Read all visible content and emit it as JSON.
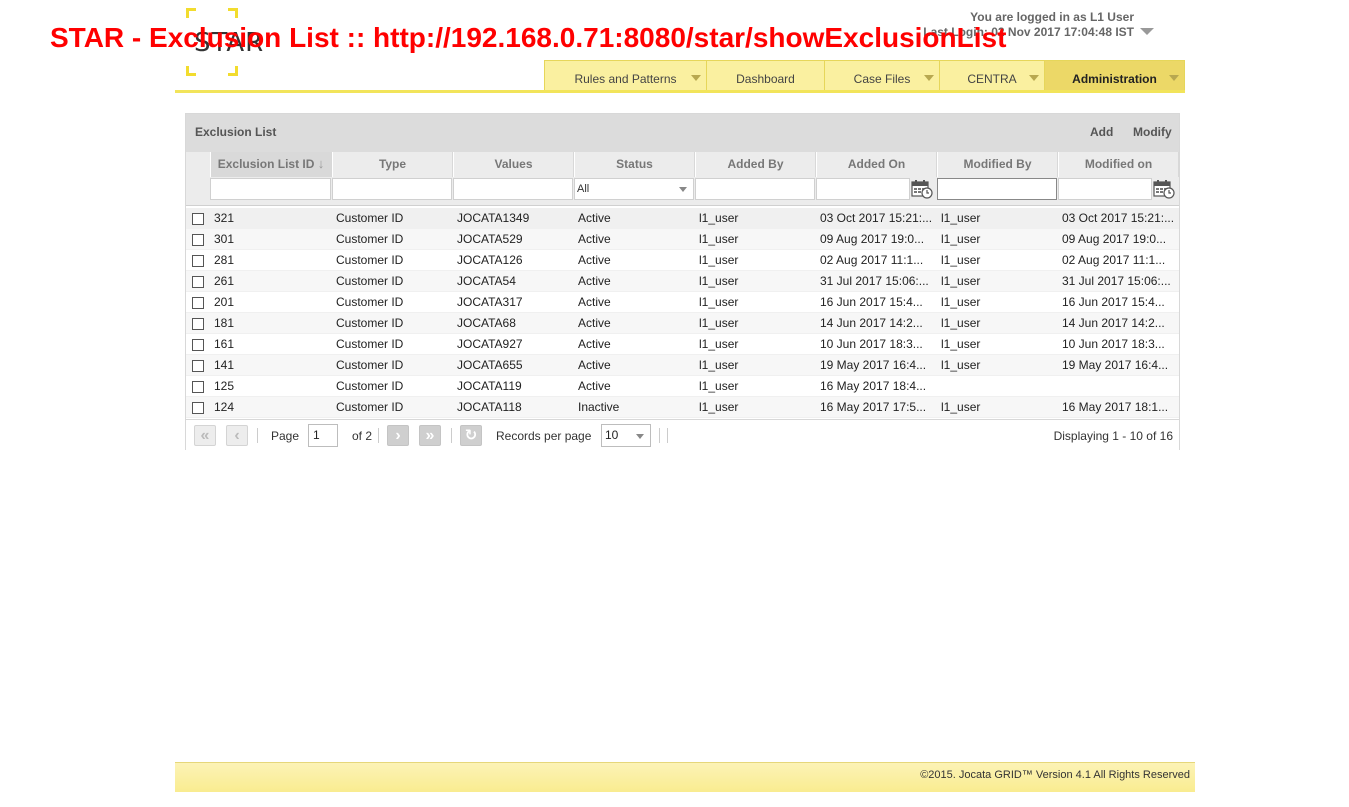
{
  "overlay": {
    "title": "STAR - Exclusion List :: http://192.168.0.71:8080/star/showExclusionList"
  },
  "logo": {
    "text": "STAR"
  },
  "user": {
    "logged_in": "You are logged in as L1 User",
    "last_login": "Last Login: 02 Nov 2017 17:04:48 IST"
  },
  "nav": {
    "tabs": [
      {
        "label": "Rules and Patterns",
        "has_menu": true,
        "active": false
      },
      {
        "label": "Dashboard",
        "has_menu": false,
        "active": false
      },
      {
        "label": "Case Files",
        "has_menu": true,
        "active": false
      },
      {
        "label": "CENTRA",
        "has_menu": true,
        "active": false
      },
      {
        "label": "Administration",
        "has_menu": true,
        "active": true
      }
    ]
  },
  "panel": {
    "title": "Exclusion List",
    "add_label": "Add",
    "modify_label": "Modify"
  },
  "grid": {
    "columns": [
      "Exclusion List ID",
      "Type",
      "Values",
      "Status",
      "Added By",
      "Added On",
      "Modified By",
      "Modified on"
    ],
    "sort_icon": "arrow-down",
    "status_filter": "All",
    "rows": [
      [
        "321",
        "Customer ID",
        "JOCATA1349",
        "Active",
        "l1_user",
        "03 Oct 2017 15:21:...",
        "l1_user",
        "03 Oct 2017 15:21:..."
      ],
      [
        "301",
        "Customer ID",
        "JOCATA529",
        "Active",
        "l1_user",
        "09 Aug 2017 19:0...",
        "l1_user",
        "09 Aug 2017 19:0..."
      ],
      [
        "281",
        "Customer ID",
        "JOCATA126",
        "Active",
        "l1_user",
        "02 Aug 2017 11:1...",
        "l1_user",
        "02 Aug 2017 11:1..."
      ],
      [
        "261",
        "Customer ID",
        "JOCATA54",
        "Active",
        "l1_user",
        "31 Jul 2017 15:06:...",
        "l1_user",
        "31 Jul 2017 15:06:..."
      ],
      [
        "201",
        "Customer ID",
        "JOCATA317",
        "Active",
        "l1_user",
        "16 Jun 2017 15:4...",
        "l1_user",
        "16 Jun 2017 15:4..."
      ],
      [
        "181",
        "Customer ID",
        "JOCATA68",
        "Active",
        "l1_user",
        "14 Jun 2017 14:2...",
        "l1_user",
        "14 Jun 2017 14:2..."
      ],
      [
        "161",
        "Customer ID",
        "JOCATA927",
        "Active",
        "l1_user",
        "10 Jun 2017 18:3...",
        "l1_user",
        "10 Jun 2017 18:3..."
      ],
      [
        "141",
        "Customer ID",
        "JOCATA655",
        "Active",
        "l1_user",
        "19 May 2017 16:4...",
        "l1_user",
        "19 May 2017 16:4..."
      ],
      [
        "125",
        "Customer ID",
        "JOCATA119",
        "Active",
        "l1_user",
        "16 May 2017 18:4...",
        "",
        ""
      ],
      [
        "124",
        "Customer ID",
        "JOCATA118",
        "Inactive",
        "l1_user",
        "16 May 2017 17:5...",
        "l1_user",
        "16 May 2017 18:1..."
      ]
    ]
  },
  "pager": {
    "page_label": "Page",
    "page_value": "1",
    "of_label": "of 2",
    "records_label": "Records per page",
    "records_value": "10",
    "display": "Displaying 1 - 10 of 16",
    "first_icon": "first-page-icon",
    "prev_icon": "prev-page-icon",
    "next_icon": "next-page-icon",
    "last_icon": "last-page-icon",
    "refresh_icon": "refresh-icon"
  },
  "footer": {
    "text": "©2015. Jocata GRID™ Version 4.1 All Rights Reserved"
  },
  "colors": {
    "accent": "#f2e45a",
    "nav_tab": "#faf0a0",
    "nav_active": "#ecd867",
    "overlay": "#ff0000"
  }
}
